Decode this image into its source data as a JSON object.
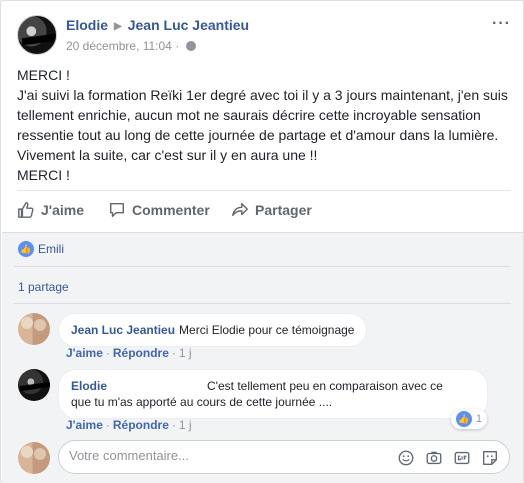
{
  "post": {
    "author": "Elodie",
    "recipient": "Jean Luc Jeantieu",
    "timestamp": "20 décembre, 11:04",
    "separator": "·",
    "lines": [
      "MERCI !",
      "J'ai suivi la formation Reïki 1er degré avec toi il y a 3 jours maintenant, j'en suis",
      "tellement enrichie, aucun mot ne saurais décrire cette incroyable sensation",
      "ressentie tout au long de cette journée de partage et d'amour dans la lumière.",
      "Vivement la suite, car c'est sur il y en aura une !!",
      "MERCI !"
    ]
  },
  "actions": {
    "like": "J'aime",
    "comment": "Commenter",
    "share": "Partager"
  },
  "reactions": {
    "liked_by": "Emili"
  },
  "shares": "1 partage",
  "comments": [
    {
      "author": "Jean Luc Jeantieu",
      "text": "Merci Elodie pour ce témoignage",
      "like": "J'aime",
      "reply": "Répondre",
      "time": "1 j"
    },
    {
      "author": "Elodie",
      "text_line1": "C'est tellement peu en comparaison avec ce",
      "text_line2": "que tu m'as apporté au cours de cette journée ....",
      "like": "J'aime",
      "reply": "Répondre",
      "time": "1 j",
      "like_count": "1"
    }
  ],
  "reply_box": {
    "placeholder": "Votre commentaire..."
  },
  "colors": {
    "link": "#365899",
    "accent": "#4267b2",
    "muted": "#90949c"
  }
}
